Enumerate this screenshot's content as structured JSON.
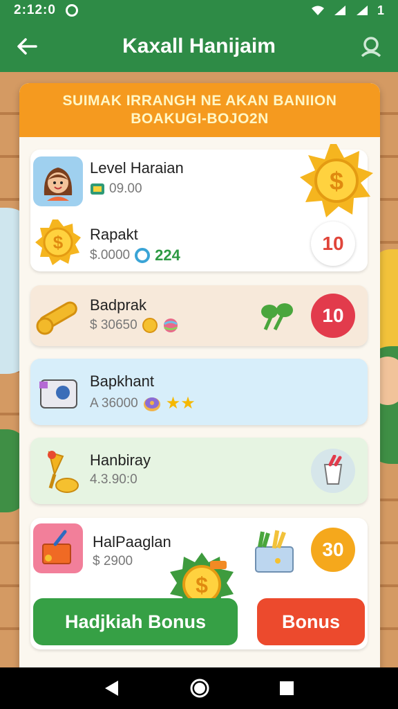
{
  "status_bar": {
    "time": "2:12:0",
    "right_text": "1"
  },
  "app_bar": {
    "title": "Kaxall Hanijaim"
  },
  "banner": {
    "line1": "SUIMAK IRRANGH NE AKAN BANIION",
    "line2": "BOAKUGI-BOJO2N"
  },
  "items": [
    {
      "name": "Level Haraian",
      "value": "09.00",
      "icon": "girl-avatar-icon"
    },
    {
      "name": "Rapakt",
      "value": "$.0000",
      "extra": "224",
      "badge": "10",
      "icon": "coin-icon"
    },
    {
      "name": "Badprak",
      "value": "$ 30650",
      "badge": "10",
      "icon": "key-icon"
    },
    {
      "name": "Bapkhant",
      "value": "A 36000",
      "icon": "machine-icon"
    },
    {
      "name": "Hanbiray",
      "value": "4.3.90:0",
      "icon": "trophy-icon"
    },
    {
      "name": "HalPaaglan",
      "value": "$ 2900",
      "badge": "30",
      "icon": "toolbox-icon"
    }
  ],
  "buttons": {
    "main_bonus": "Hadjkiah Bonus",
    "bonus": "Bonus"
  },
  "colors": {
    "primary_green": "#2e8b46",
    "banner_orange": "#f59a1f",
    "badge_red": "#e23b4c",
    "badge_orange": "#f5a81c",
    "button_red": "#ec4a2d"
  }
}
